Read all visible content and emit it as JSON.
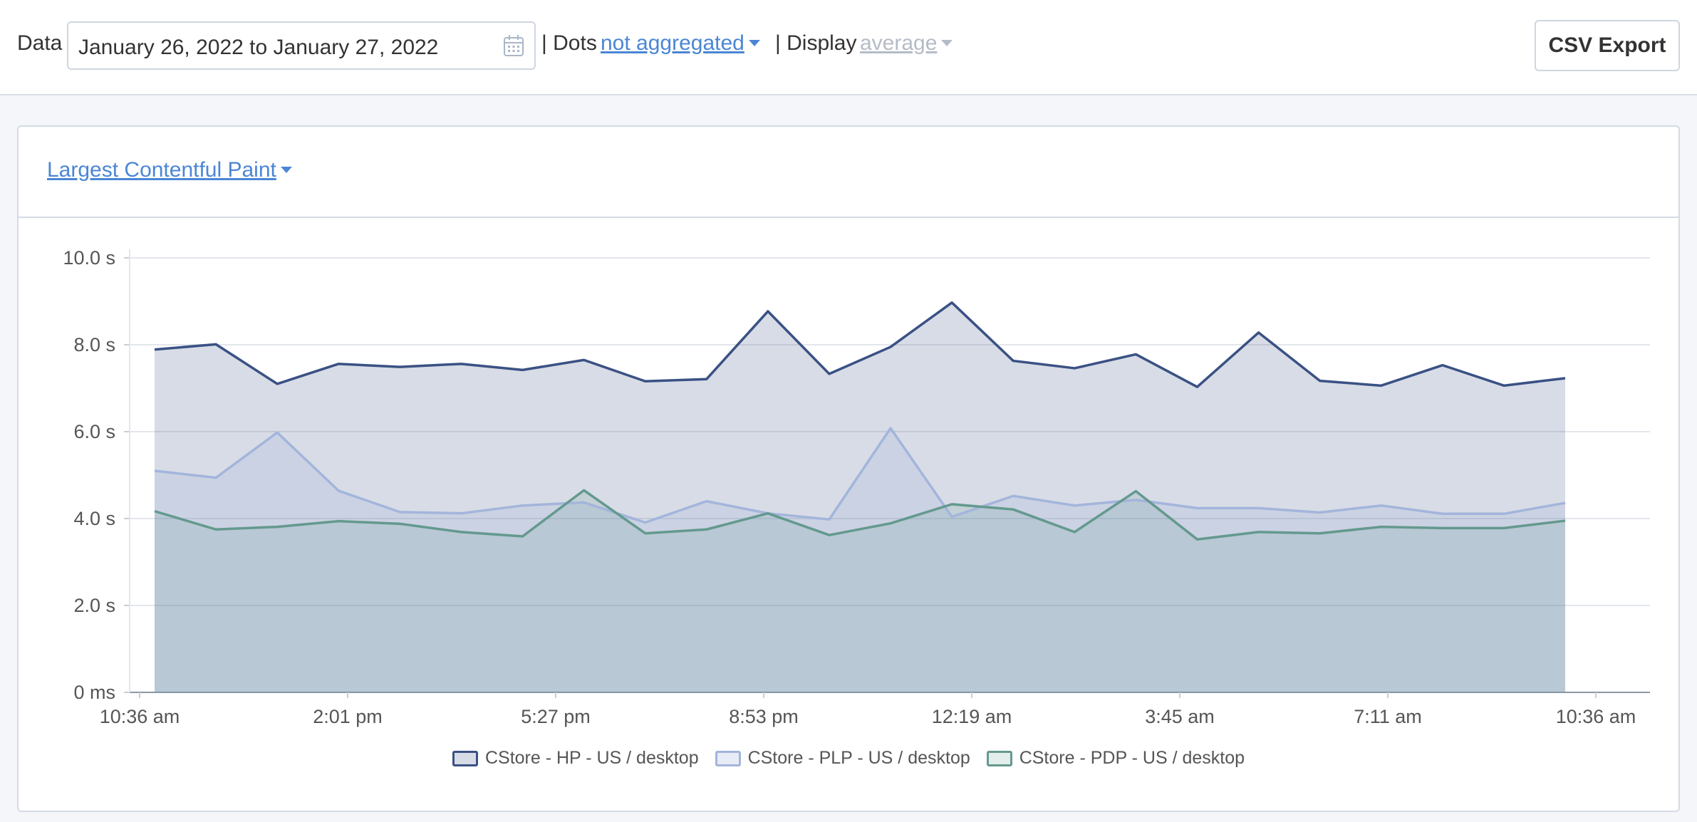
{
  "toolbar": {
    "data_label": "Data",
    "date_range": "January 26, 2022 to January 27, 2022",
    "dots_label": "| Dots",
    "dots_value": "not aggregated",
    "display_label": "| Display",
    "display_value": "average",
    "export_label": "CSV Export"
  },
  "panel": {
    "metric": "Largest Contentful Paint"
  },
  "colors": {
    "hp": "#3a5184",
    "plp": "#a3b5db",
    "pdp": "#64998e",
    "link": "#4a86d4"
  },
  "chart_data": {
    "type": "area",
    "y_tick_labels": [
      "0 ms",
      "2.0 s",
      "4.0 s",
      "6.0 s",
      "8.0 s",
      "10.0 s"
    ],
    "y_ticks": [
      0,
      2,
      4,
      6,
      8,
      10
    ],
    "ylim": [
      0,
      10
    ],
    "x_tick_labels": [
      "10:36 am",
      "2:01 pm",
      "5:27 pm",
      "8:53 pm",
      "12:19 am",
      "3:45 am",
      "7:11 am",
      "10:36 am"
    ],
    "grid": true,
    "legend_position": "bottom",
    "series": [
      {
        "name": "CStore - HP - US / desktop",
        "values": [
          7.89,
          8.01,
          7.1,
          7.56,
          7.49,
          7.56,
          7.42,
          7.65,
          7.16,
          7.21,
          8.77,
          7.33,
          7.95,
          8.97,
          7.63,
          7.46,
          7.78,
          7.03,
          8.28,
          7.17,
          7.06,
          7.53,
          7.06,
          7.23
        ]
      },
      {
        "name": "CStore - PLP - US / desktop",
        "values": [
          5.1,
          4.94,
          5.98,
          4.64,
          4.15,
          4.12,
          4.3,
          4.37,
          3.91,
          4.4,
          4.12,
          3.98,
          6.08,
          4.04,
          4.52,
          4.3,
          4.43,
          4.24,
          4.24,
          4.14,
          4.3,
          4.11,
          4.11,
          4.36
        ]
      },
      {
        "name": "CStore - PDP - US / desktop",
        "values": [
          4.17,
          3.75,
          3.81,
          3.94,
          3.88,
          3.69,
          3.59,
          4.65,
          3.66,
          3.75,
          4.12,
          3.62,
          3.89,
          4.33,
          4.21,
          3.69,
          4.63,
          3.52,
          3.69,
          3.66,
          3.81,
          3.78,
          3.78,
          3.95
        ]
      }
    ]
  }
}
